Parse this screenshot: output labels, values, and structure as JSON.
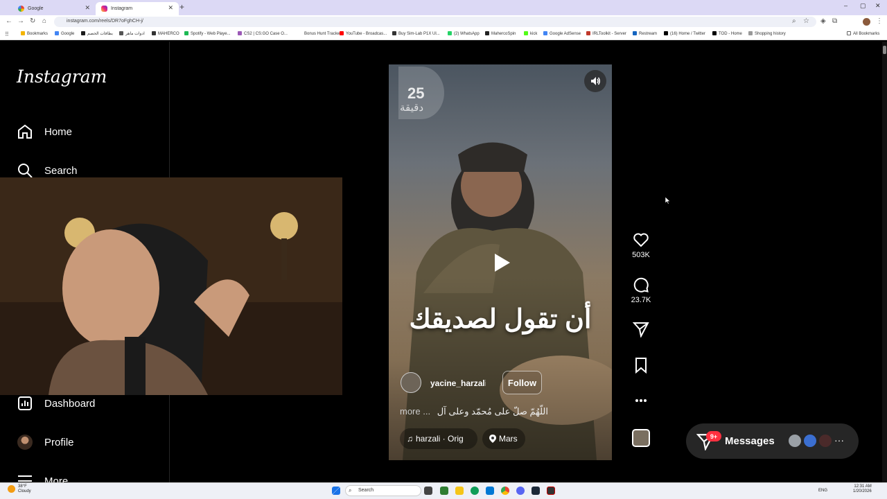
{
  "browser": {
    "tabs": [
      {
        "title": "Google",
        "active": false
      },
      {
        "title": "Instagram",
        "active": true
      }
    ],
    "url": "instagram.com/reels/DR7oFghCH-j/",
    "bookmarks": [
      "Bookmarks",
      "Google",
      "بطاقات الخصم",
      "ادوات ماهر",
      "MAHERCO",
      "Spotify - Web Playe...",
      "CS2 | CS:GO Case O...",
      "Bonus Hunt Tracker",
      "YouTube - Broadcas...",
      "Buy Sim-Lab P1X Ul...",
      "(2) WhatsApp",
      "MahercoSpin",
      "kick",
      "Google AdSense",
      "IRLToolkit - Server",
      "Restream",
      "(16) Home / Twitter",
      "TOD - Home",
      "Shopping history"
    ],
    "all_bookmarks": "All Bookmarks"
  },
  "instagram": {
    "logo": "Instagram",
    "nav": {
      "home": "Home",
      "search": "Search",
      "dashboard": "Dashboard",
      "profile": "Profile",
      "more": "More"
    }
  },
  "reel": {
    "badge_number": "25",
    "badge_word": "دقيقة",
    "overlay_text": "أن تقول لصديقك",
    "author": "yacine_harzali",
    "follow": "Follow",
    "caption": "اللّهُمّ صلّ على مُحمّد وعلى آل",
    "caption_more": "more ...",
    "audio": "harzali · Orig",
    "location": "Mars"
  },
  "actions": {
    "likes": "503K",
    "comments": "23.7K"
  },
  "messages": {
    "label": "Messages",
    "badge": "9+"
  },
  "taskbar": {
    "weather_temp": "38°F",
    "weather_desc": "Cloudy",
    "search": "Search",
    "lang": "ENG",
    "time": "12:31 AM",
    "date": "1/20/2026"
  },
  "colors": {
    "tabstrip": "#dcd9f5",
    "ig_bg": "#000000",
    "messages_bg": "#262626",
    "notif_red": "#ff3040"
  }
}
